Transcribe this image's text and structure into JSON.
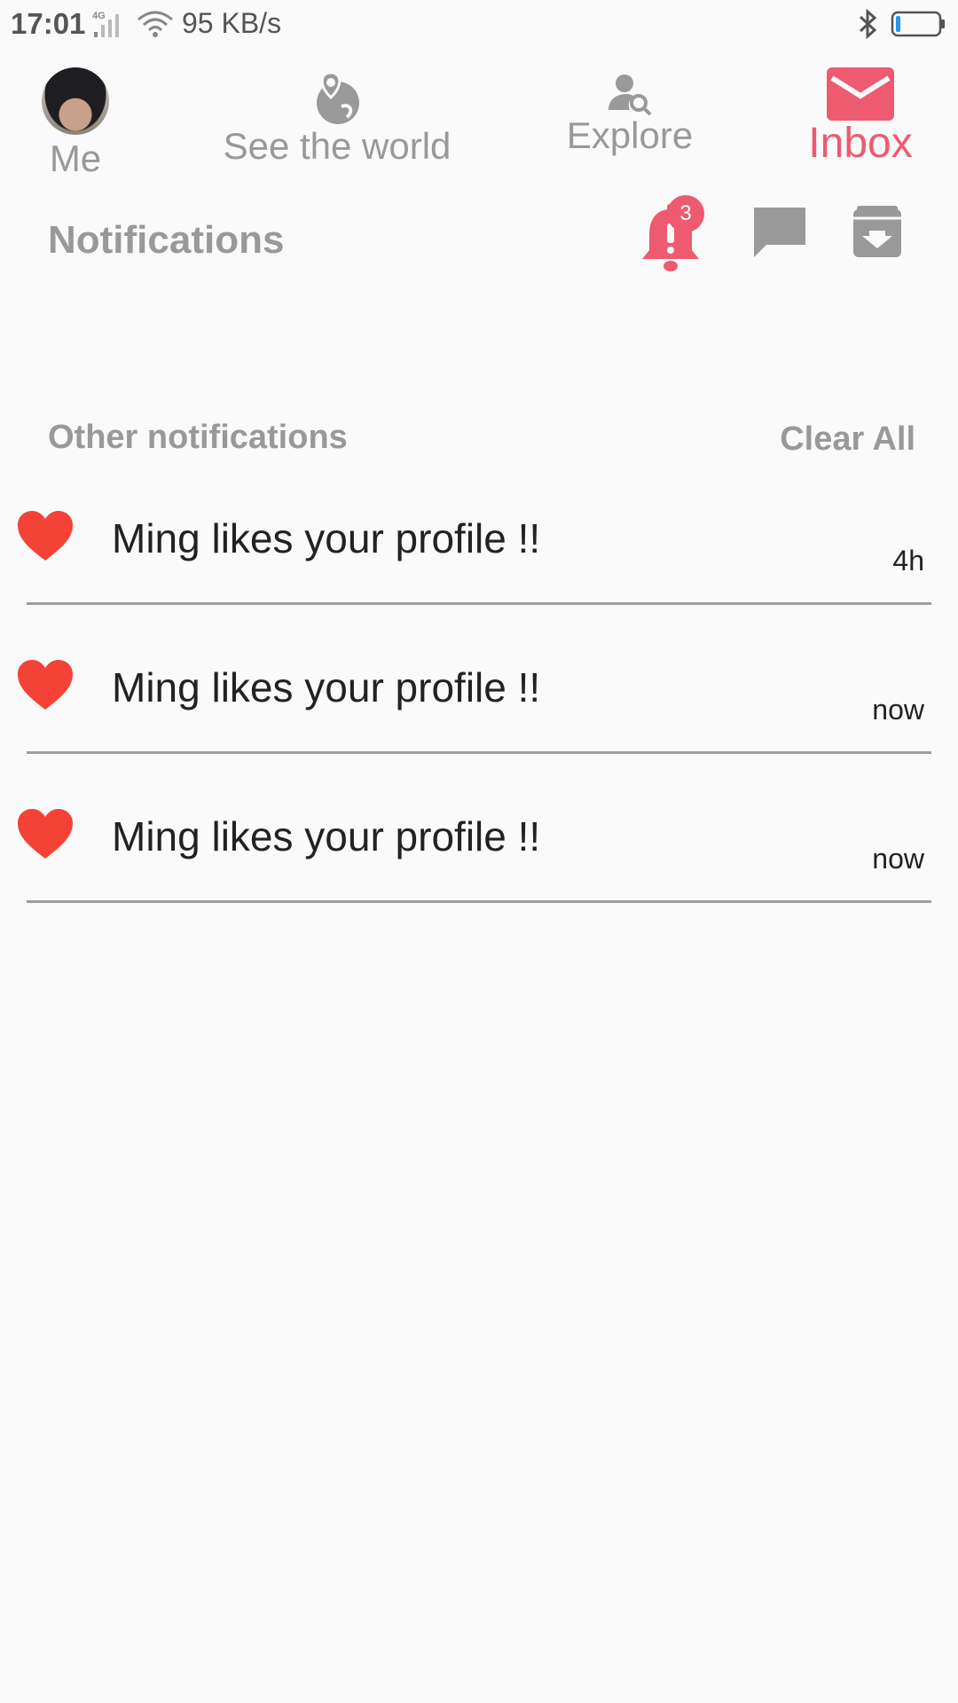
{
  "status_bar": {
    "time": "17:01",
    "network_speed": "95 KB/s",
    "signal_label": "4G"
  },
  "nav": {
    "me_label": "Me",
    "world_label": "See the world",
    "explore_label": "Explore",
    "inbox_label": "Inbox",
    "active_color": "#ee5a6f",
    "inactive_color": "#999999"
  },
  "notifications_header": {
    "title": "Notifications",
    "bell_badge": "3"
  },
  "section": {
    "title": "Other notifications",
    "clear_all_label": "Clear All"
  },
  "notifications": [
    {
      "icon": "heart-icon",
      "text": "Ming likes your profile !!",
      "time": "4h"
    },
    {
      "icon": "heart-icon",
      "text": "Ming likes your profile !!",
      "time": "now"
    },
    {
      "icon": "heart-icon",
      "text": "Ming likes your profile !!",
      "time": "now"
    }
  ],
  "colors": {
    "heart": "#f44336",
    "accent": "#ee5a6f",
    "muted": "#999999"
  }
}
